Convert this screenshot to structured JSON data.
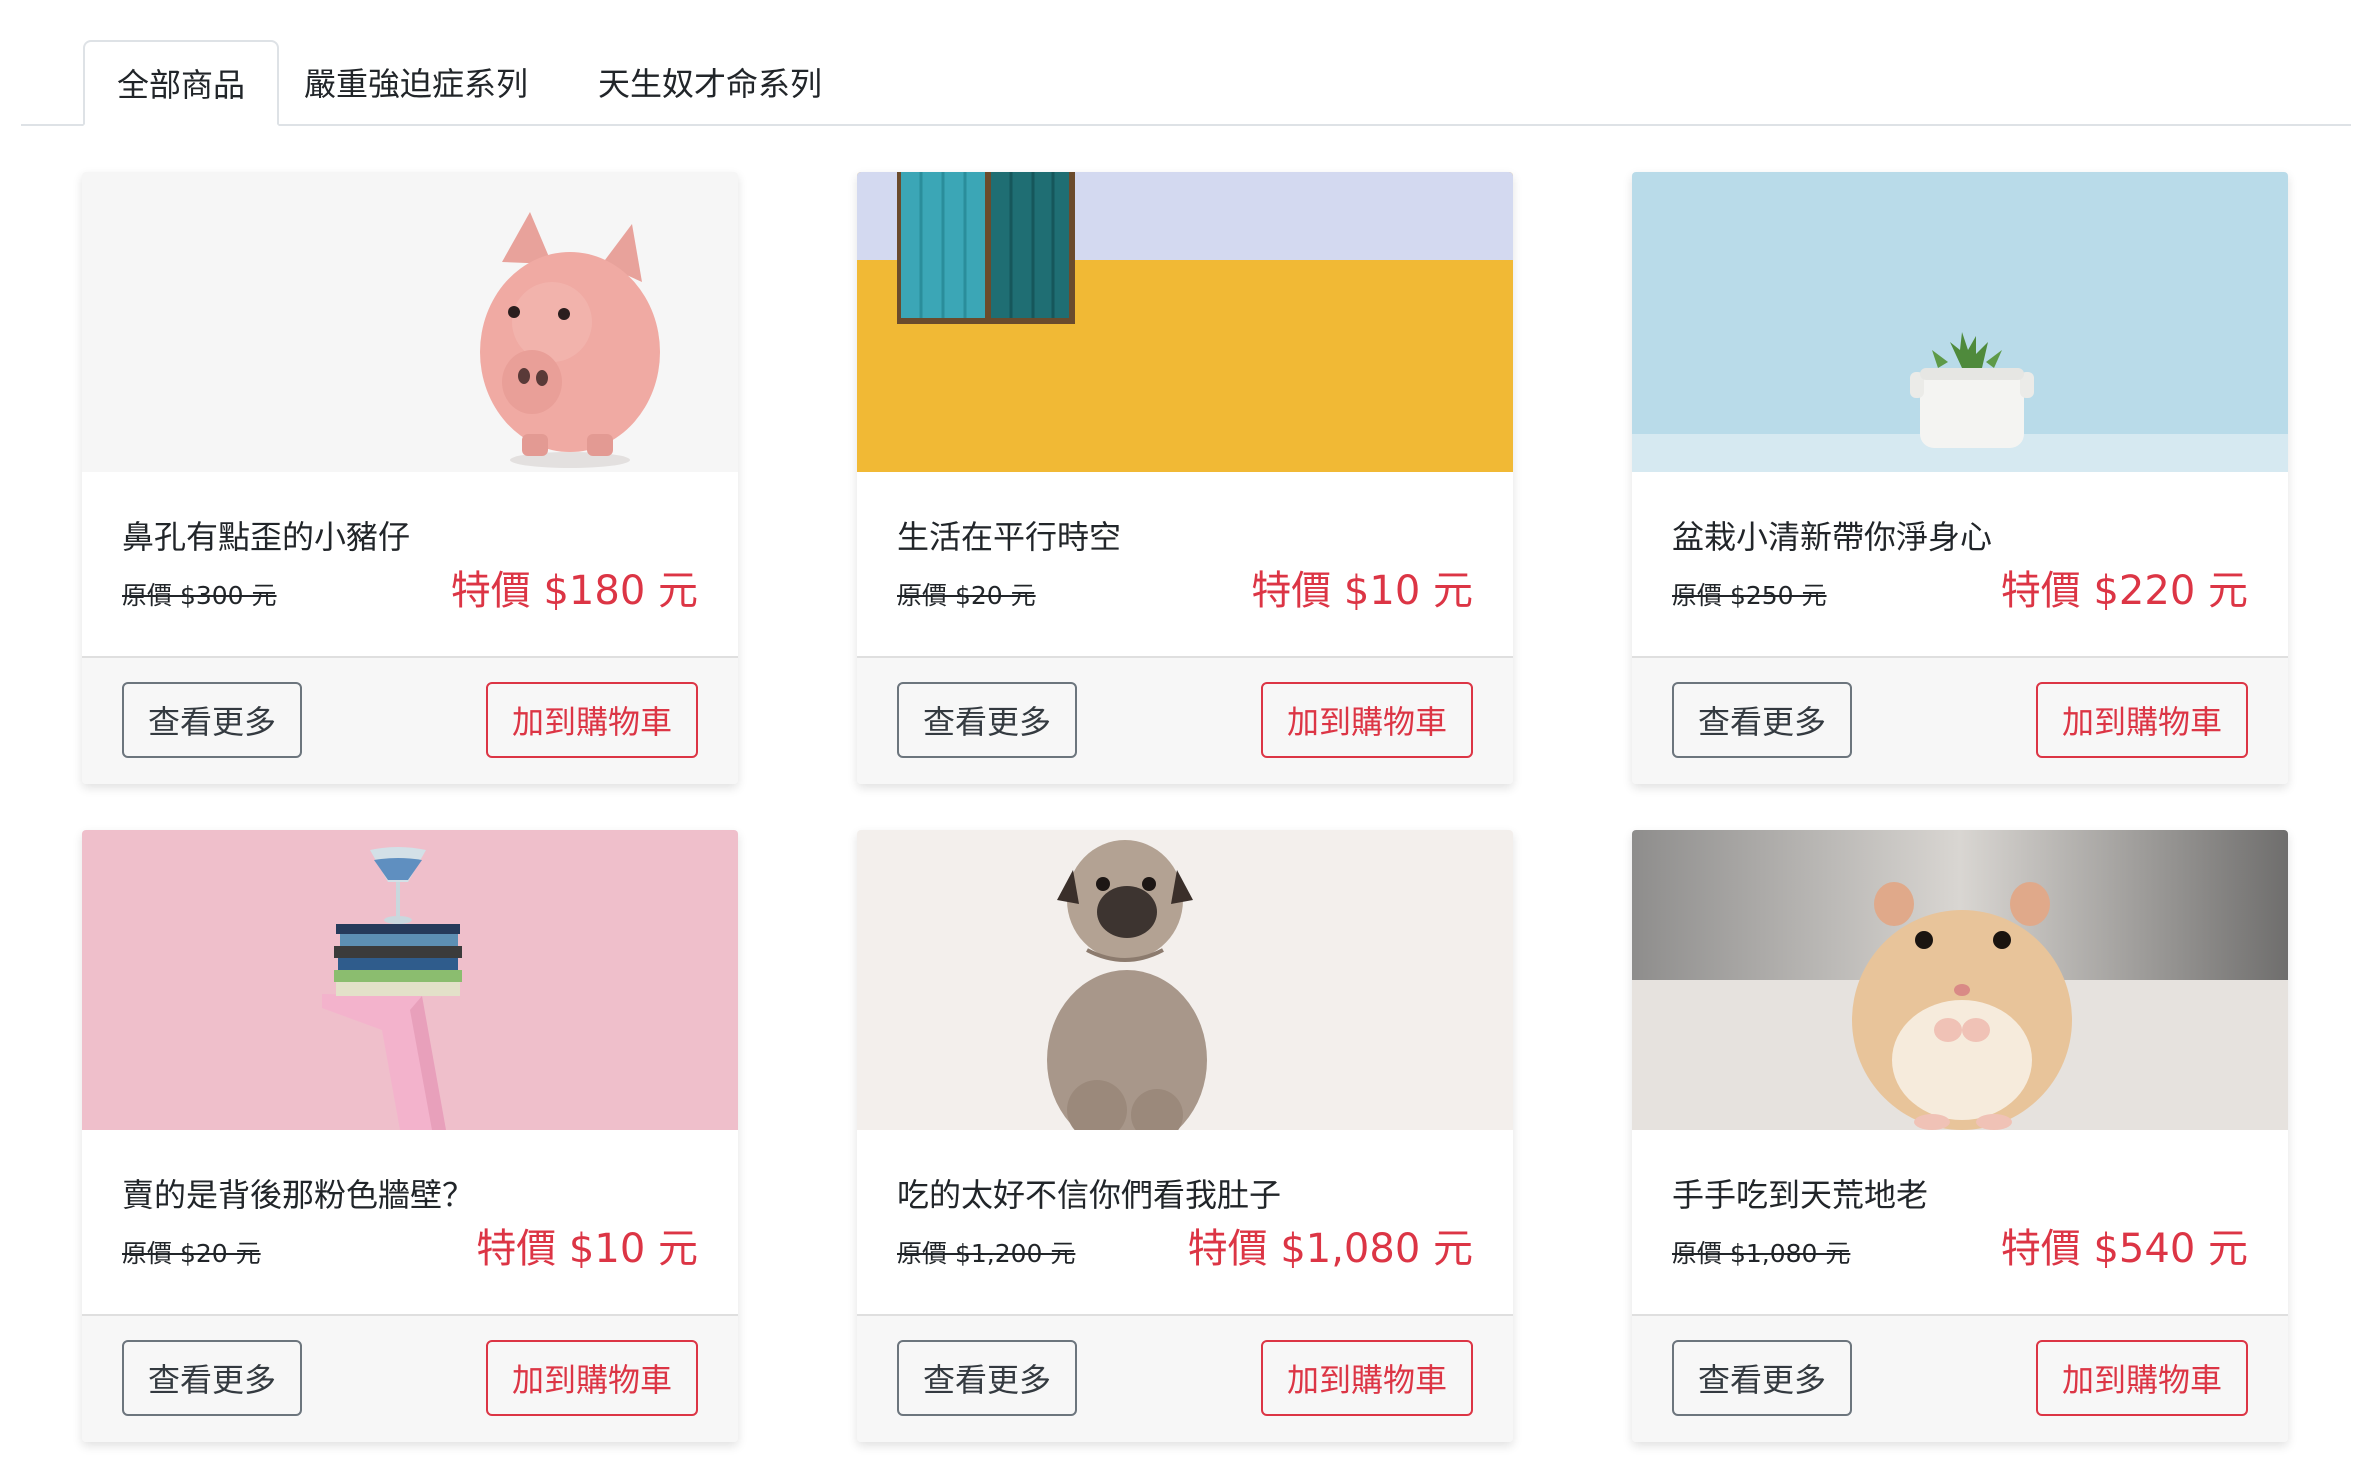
{
  "tabs": [
    {
      "label": "全部商品",
      "active": true
    },
    {
      "label": "嚴重強迫症系列",
      "active": false
    },
    {
      "label": "天生奴才命系列",
      "active": false
    }
  ],
  "products": [
    {
      "title": "鼻孔有點歪的小豬仔",
      "original_price": "原價 $300 元",
      "sale_price": "特價 $180 元",
      "image": "pink-piggy-bank-photo",
      "more_label": "查看更多",
      "cart_label": "加到購物車"
    },
    {
      "title": "生活在平行時空",
      "original_price": "原價 $20 元",
      "sale_price": "特價 $10 元",
      "image": "yellow-wall-teal-door-photo",
      "more_label": "查看更多",
      "cart_label": "加到購物車"
    },
    {
      "title": "盆栽小清新帶你淨身心",
      "original_price": "原價 $250 元",
      "sale_price": "特價 $220 元",
      "image": "succulent-pot-photo",
      "more_label": "查看更多",
      "cart_label": "加到購物車"
    },
    {
      "title": "賣的是背後那粉色牆壁？",
      "original_price": "原價 $20 元",
      "sale_price": "特價 $10 元",
      "image": "pink-wall-books-glass-photo",
      "more_label": "查看更多",
      "cart_label": "加到購物車"
    },
    {
      "title": "吃的太好不信你們看我肚子",
      "original_price": "原價 $1,200 元",
      "sale_price": "特價 $1,080 元",
      "image": "pug-dog-photo",
      "more_label": "查看更多",
      "cart_label": "加到購物車"
    },
    {
      "title": "手手吃到天荒地老",
      "original_price": "原價 $1,080 元",
      "sale_price": "特價 $540 元",
      "image": "hamster-photo",
      "more_label": "查看更多",
      "cart_label": "加到購物車"
    }
  ],
  "colors": {
    "sale": "#dc3545",
    "footer_bg": "#f7f7f7",
    "tab_border": "#dee2e6"
  }
}
